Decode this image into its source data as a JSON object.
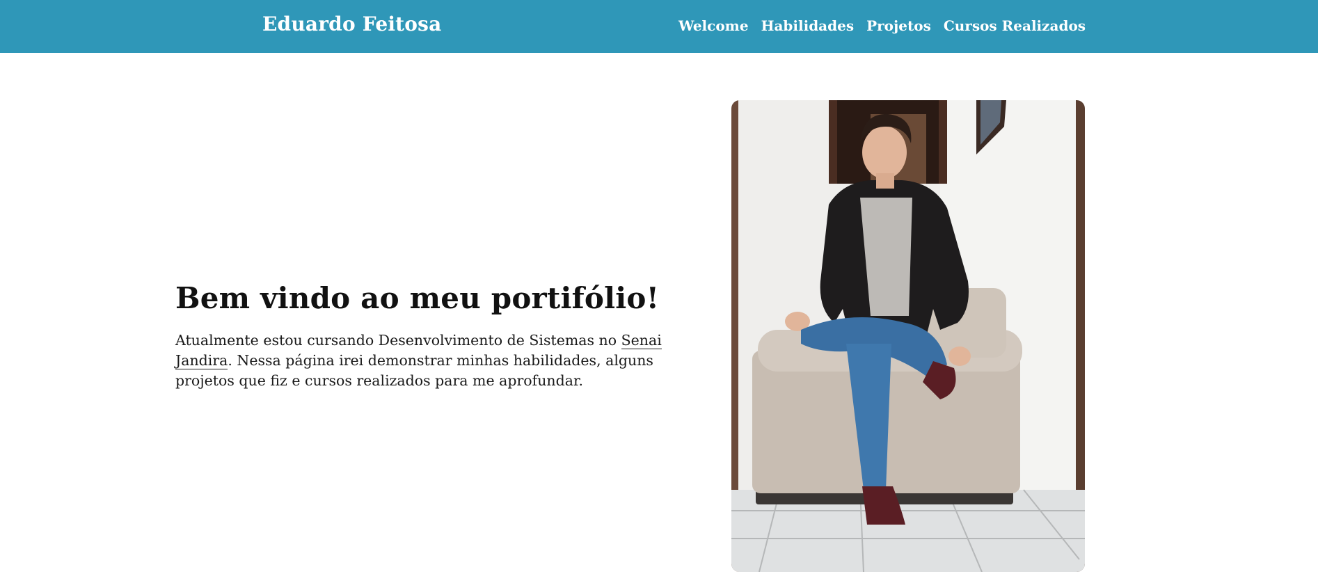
{
  "navbar": {
    "brand": "Eduardo Feitosa",
    "links": [
      {
        "label": "Welcome"
      },
      {
        "label": "Habilidades"
      },
      {
        "label": "Projetos"
      },
      {
        "label": "Cursos Realizados"
      }
    ],
    "background_color": "#2f97b8"
  },
  "hero": {
    "title": "Bem vindo ao meu portifólio!",
    "description_before": "Atualmente estou cursando Desenvolvimento de Sistemas no ",
    "description_link": "Senai Jandira",
    "description_after": ". Nessa página irei demonstrar minhas habilidades, alguns projetos que fiz e cursos realizados para me aprofundar."
  },
  "photo": {
    "icon": "profile-photo"
  }
}
